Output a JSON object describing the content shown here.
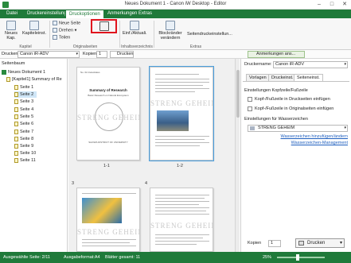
{
  "window": {
    "title": "Neues Dokument 1 - Canon iW Desktop - Editor",
    "minimize": "–",
    "maximize": "□",
    "close": "✕"
  },
  "ribbon_tabs": [
    "Datei",
    "Druckereinstellungen",
    "Druckoptionen",
    "Anmerkungen",
    "Extras"
  ],
  "ribbon": {
    "new_chapter": "Neues Kap.",
    "chapter_settings": "Kapiteleinst.",
    "new_page": "Neue Seite",
    "rotate": "Drehen",
    "share": "Teilen",
    "add_contents": "Einf./Aktuali.",
    "blank_page_insert": "Blockränder verändern",
    "page_print_settings": "Seitendruckeinstellun...",
    "group_chapter": "Kapitel",
    "group_originals": "Originalseiten",
    "group_contents": "Inhaltsverzeichnis",
    "group_extras": "Extras"
  },
  "toolbar": {
    "printer_label": "Drucken",
    "printer_value": "Canon iR-ADV",
    "copies_label": "Kopien",
    "copies_value": "1",
    "print_label": "Drucken",
    "annotation_tab": "Anmerkungen ans..."
  },
  "left_panel": {
    "header": "Seitenbaum",
    "items": [
      "Neues Dokument 1",
      "[Kapitel1] Summary of Re",
      "Seite 1",
      "Seite 2",
      "Seite 3",
      "Seite 4",
      "Seite 5",
      "Seite 6",
      "Seite 7",
      "Seite 8",
      "Seite 9",
      "Seite 10",
      "Seite 11"
    ]
  },
  "pages": {
    "watermark": "STRENG GEHEIM",
    "labels": [
      "1-1",
      "1-2",
      "3",
      "4"
    ],
    "page1_title": "Summary of Research",
    "page1_subtitle": "Basic Research on Natural Ecosystem",
    "page1_header": "No. 02-Celestiales",
    "page1_footer": "SHOWA DISTRICT OF UNIVERSITY"
  },
  "right_panel": {
    "printer_name_label": "Druckername:",
    "printer_name_value": "Canon iR-ADV",
    "tabs": [
      "Vorlagen",
      "Druckeinst.",
      "Seiteneinst."
    ],
    "section_headfoot": "Einstellungen Kopfzeile/Fußzeile",
    "chk_print": "Kopf-/Fußzeile in Druckseiten einfügen",
    "chk_original": "Kopf-/Fußzeile in Originalseiten einfügen",
    "section_watermark": "Einstellungen für Wasserzeichen",
    "watermark_value": "STRENG GEHEIM",
    "link_add": "Wasserzeichen hinzufügen/ändern",
    "link_manage": "Wasserzeichen-Management",
    "copies_label": "Kopien",
    "copies_value": "1",
    "print_button": "Drucken"
  },
  "status": {
    "selected": "Ausgewählte Seite: 2/11",
    "format": "Ausgabeformat:A4",
    "total": "Blätter gesamt: 11",
    "zoom": "25%"
  }
}
